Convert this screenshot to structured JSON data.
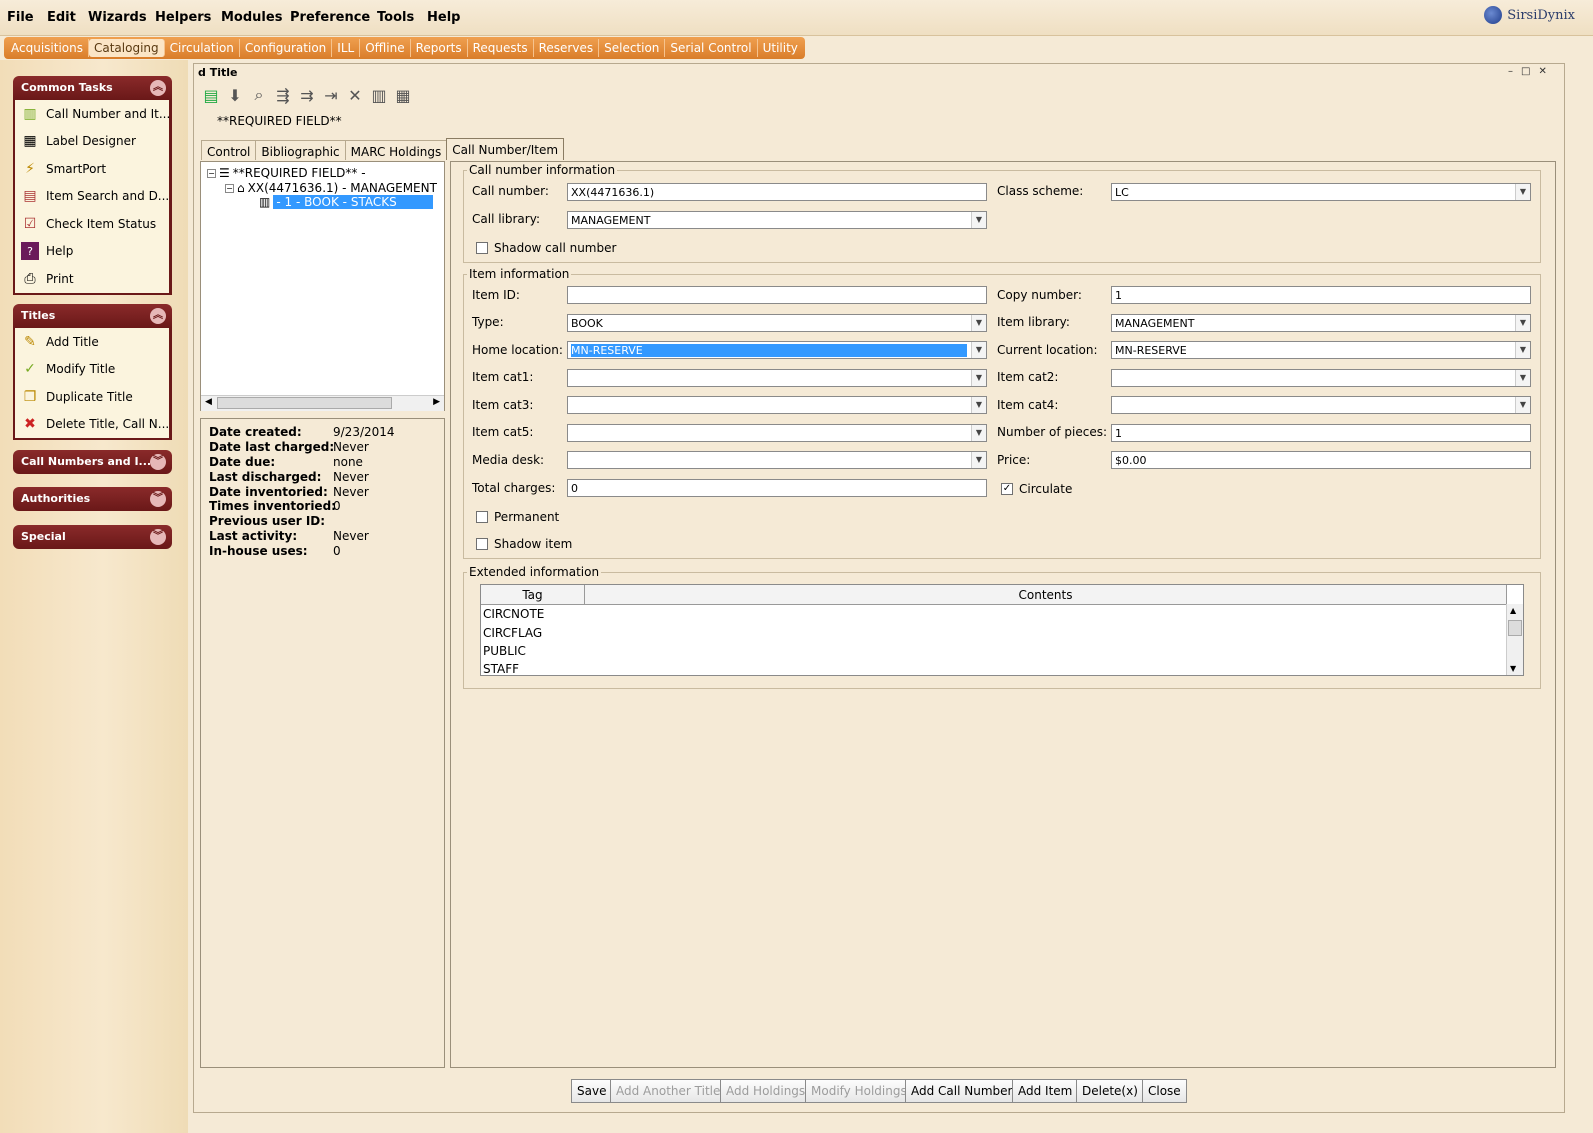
{
  "menu": [
    "File",
    "Edit",
    "Wizards",
    "Helpers",
    "Modules",
    "Preference",
    "Tools",
    "Help"
  ],
  "brand": "SirsiDynix",
  "modules": [
    "Acquisitions",
    "Cataloging",
    "Circulation",
    "Configuration",
    "ILL",
    "Offline",
    "Reports",
    "Requests",
    "Reserves",
    "Selection",
    "Serial Control",
    "Utility"
  ],
  "active_module": "Cataloging",
  "sidebar": {
    "common_tasks": {
      "title": "Common Tasks",
      "items": [
        "Call Number and It...",
        "Label Designer",
        "SmartPort",
        "Item Search and D...",
        "Check Item Status",
        "Help",
        "Print"
      ]
    },
    "titles": {
      "title": "Titles",
      "items": [
        "Add Title",
        "Modify Title",
        "Duplicate Title",
        "Delete Title, Call N..."
      ]
    },
    "call_numbers": "Call Numbers and I...",
    "authorities": "Authorities",
    "special": "Special"
  },
  "window": {
    "title": "d Title",
    "required_label": "**REQUIRED FIELD**"
  },
  "tabs": [
    "Control",
    "Bibliographic",
    "MARC Holdings",
    "Call Number/Item"
  ],
  "active_tab": "Call Number/Item",
  "tree": {
    "root": "**REQUIRED FIELD** -",
    "callnum": "XX(4471636.1) - MANAGEMENT",
    "item": "- 1 - BOOK - STACKS"
  },
  "info": [
    {
      "k": "Date created:",
      "v": "9/23/2014"
    },
    {
      "k": "Date last charged:",
      "v": "Never"
    },
    {
      "k": "Date due:",
      "v": "none"
    },
    {
      "k": "Last discharged:",
      "v": "Never"
    },
    {
      "k": "Date inventoried:",
      "v": "Never"
    },
    {
      "k": "Times inventoried:",
      "v": "0"
    },
    {
      "k": "Previous user ID:",
      "v": ""
    },
    {
      "k": "Last activity:",
      "v": "Never"
    },
    {
      "k": "In-house uses:",
      "v": "0"
    }
  ],
  "call_info": {
    "legend": "Call number information",
    "call_number_label": "Call number:",
    "call_number": "XX(4471636.1)",
    "class_scheme_label": "Class scheme:",
    "class_scheme": "LC",
    "call_library_label": "Call library:",
    "call_library": "MANAGEMENT",
    "shadow_label": "Shadow call number"
  },
  "item_info": {
    "legend": "Item information",
    "item_id_label": "Item ID:",
    "item_id": "",
    "copy_number_label": "Copy number:",
    "copy_number": "1",
    "type_label": "Type:",
    "type": "BOOK",
    "item_library_label": "Item library:",
    "item_library": "MANAGEMENT",
    "home_location_label": "Home location:",
    "home_location": "MN-RESERVE",
    "current_location_label": "Current location:",
    "current_location": "MN-RESERVE",
    "cat1_label": "Item cat1:",
    "cat2_label": "Item cat2:",
    "cat3_label": "Item cat3:",
    "cat4_label": "Item cat4:",
    "cat5_label": "Item cat5:",
    "pieces_label": "Number of pieces:",
    "pieces": "1",
    "media_label": "Media desk:",
    "price_label": "Price:",
    "price": "$0.00",
    "charges_label": "Total charges:",
    "charges": "0",
    "circulate_label": "Circulate",
    "permanent_label": "Permanent",
    "shadow_item_label": "Shadow item"
  },
  "extended": {
    "legend": "Extended information",
    "col_tag": "Tag",
    "col_contents": "Contents",
    "rows": [
      "CIRCNOTE",
      "CIRCFLAG",
      "PUBLIC",
      "STAFF"
    ]
  },
  "buttons": {
    "save": "Save",
    "add_another_title": "Add Another Title",
    "add_holdings": "Add Holdings",
    "modify_holdings": "Modify Holdings",
    "add_call_number": "Add Call Number",
    "add_item": "Add Item",
    "delete": "Delete(x)",
    "close": "Close"
  }
}
